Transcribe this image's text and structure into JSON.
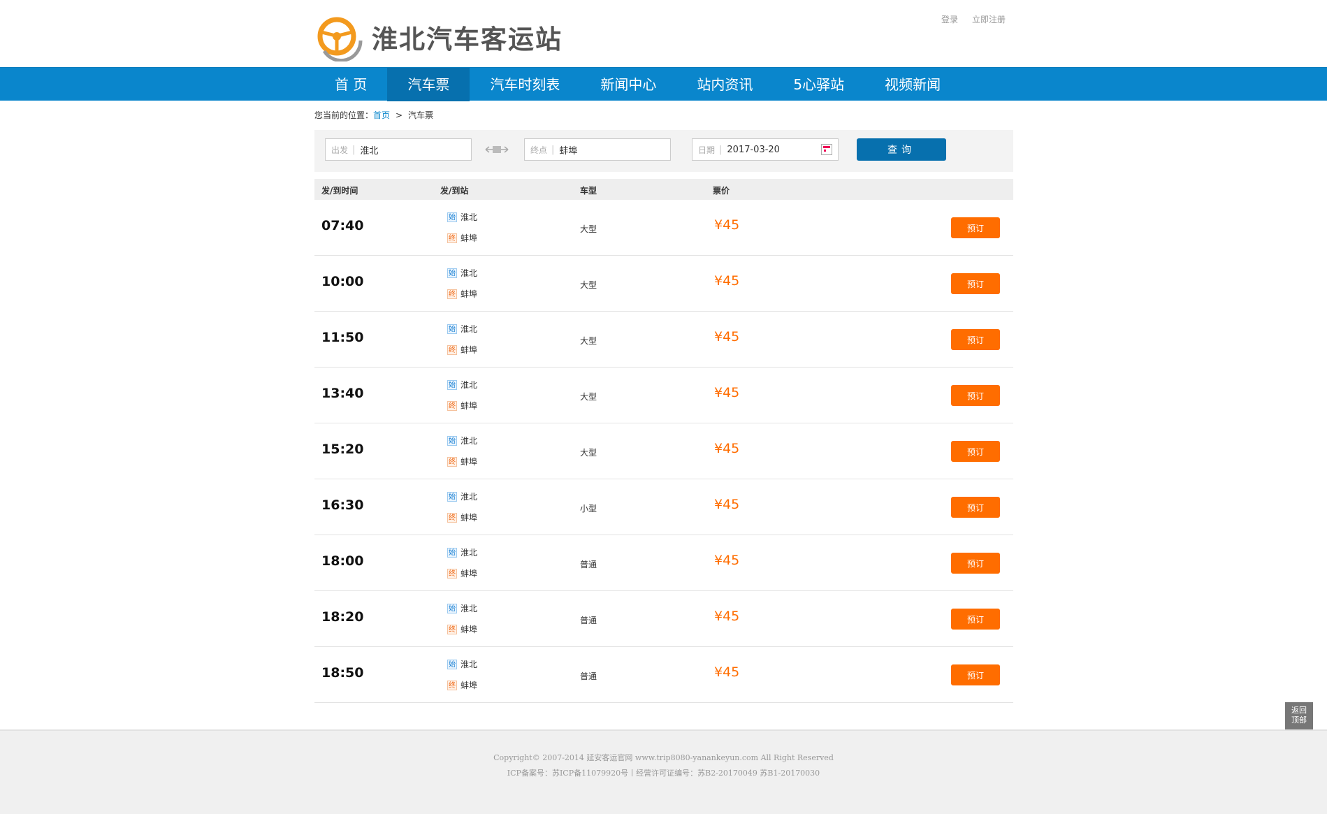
{
  "site": {
    "name": "淮北汽车客运站"
  },
  "top_links": {
    "login": "登录",
    "register": "立即注册"
  },
  "nav": [
    {
      "label": "首 页",
      "active": false
    },
    {
      "label": "汽车票",
      "active": true
    },
    {
      "label": "汽车时刻表",
      "active": false
    },
    {
      "label": "新闻中心",
      "active": false
    },
    {
      "label": "站内资讯",
      "active": false
    },
    {
      "label": "5心驿站",
      "active": false
    },
    {
      "label": "视频新闻",
      "active": false
    }
  ],
  "breadcrumb": {
    "prefix": "您当前的位置：",
    "home": "首页",
    "separator": ">",
    "current": "汽车票"
  },
  "search": {
    "from_label": "出发",
    "from_value": "淮北",
    "to_label": "终点",
    "to_value": "蚌埠",
    "date_label": "日期",
    "date_value": "2017-03-20",
    "query_label": "查询"
  },
  "table": {
    "headers": {
      "time": "发/到时间",
      "station": "发/到站",
      "type": "车型",
      "price": "票价"
    },
    "start_badge": "始",
    "end_badge": "终",
    "book_label": "预订",
    "rows": [
      {
        "time": "07:40",
        "from": "淮北",
        "to": "蚌埠",
        "type": "大型",
        "price": "¥45"
      },
      {
        "time": "10:00",
        "from": "淮北",
        "to": "蚌埠",
        "type": "大型",
        "price": "¥45"
      },
      {
        "time": "11:50",
        "from": "淮北",
        "to": "蚌埠",
        "type": "大型",
        "price": "¥45"
      },
      {
        "time": "13:40",
        "from": "淮北",
        "to": "蚌埠",
        "type": "大型",
        "price": "¥45"
      },
      {
        "time": "15:20",
        "from": "淮北",
        "to": "蚌埠",
        "type": "大型",
        "price": "¥45"
      },
      {
        "time": "16:30",
        "from": "淮北",
        "to": "蚌埠",
        "type": "小型",
        "price": "¥45"
      },
      {
        "time": "18:00",
        "from": "淮北",
        "to": "蚌埠",
        "type": "普通",
        "price": "¥45"
      },
      {
        "time": "18:20",
        "from": "淮北",
        "to": "蚌埠",
        "type": "普通",
        "price": "¥45"
      },
      {
        "time": "18:50",
        "from": "淮北",
        "to": "蚌埠",
        "type": "普通",
        "price": "¥45"
      }
    ]
  },
  "back_to_top": {
    "line1": "返回",
    "line2": "顶部"
  },
  "footer": {
    "line1": "Copyright© 2007-2014 延安客运官网 www.trip8080-yanankeyun.com All Right Reserved",
    "line2": "ICP备案号：苏ICP备11079920号丨经营许可证编号：苏B2-20170049 苏B1-20170030"
  },
  "colors": {
    "nav_blue": "#0a86cc",
    "nav_active": "#0770ae",
    "accent_orange": "#ff6d00"
  }
}
